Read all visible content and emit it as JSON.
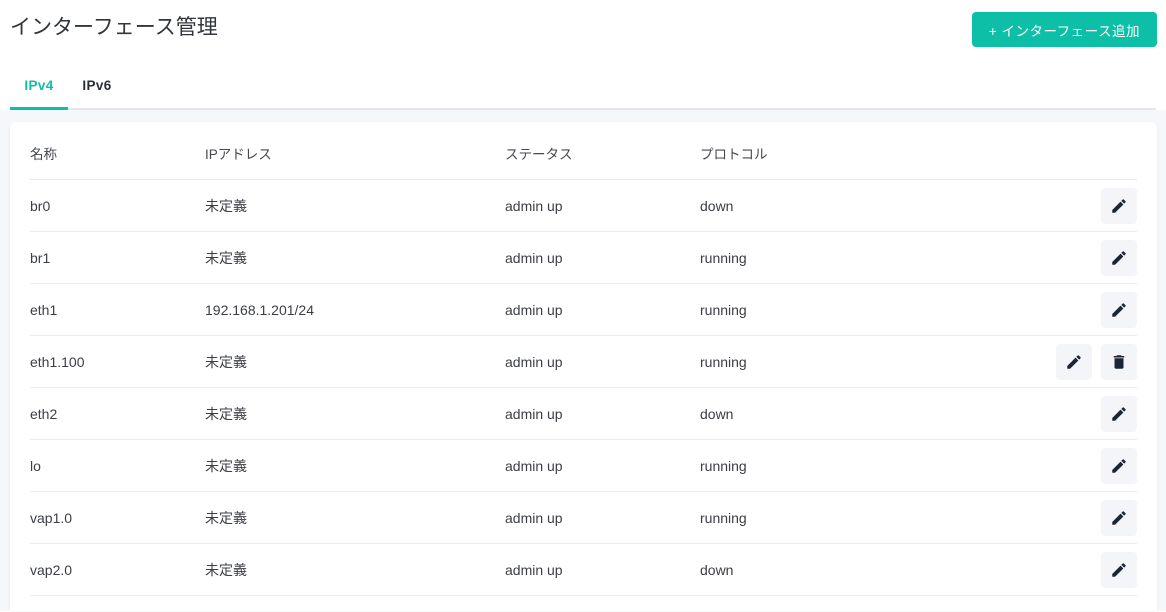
{
  "header": {
    "title": "インターフェース管理",
    "add_button_label": "+  インターフェース追加"
  },
  "tabs": [
    {
      "label": "IPv4",
      "active": true
    },
    {
      "label": "IPv6",
      "active": false
    }
  ],
  "table": {
    "columns": [
      "名称",
      "IPアドレス",
      "ステータス",
      "プロトコル"
    ],
    "rows": [
      {
        "name": "br0",
        "ip": "未定義",
        "status": "admin up",
        "protocol": "down",
        "actions": [
          "edit"
        ]
      },
      {
        "name": "br1",
        "ip": "未定義",
        "status": "admin up",
        "protocol": "running",
        "actions": [
          "edit"
        ]
      },
      {
        "name": "eth1",
        "ip": "192.168.1.201/24",
        "status": "admin up",
        "protocol": "running",
        "actions": [
          "edit"
        ]
      },
      {
        "name": "eth1.100",
        "ip": "未定義",
        "status": "admin up",
        "protocol": "running",
        "actions": [
          "edit",
          "delete"
        ]
      },
      {
        "name": "eth2",
        "ip": "未定義",
        "status": "admin up",
        "protocol": "down",
        "actions": [
          "edit"
        ]
      },
      {
        "name": "lo",
        "ip": "未定義",
        "status": "admin up",
        "protocol": "running",
        "actions": [
          "edit"
        ]
      },
      {
        "name": "vap1.0",
        "ip": "未定義",
        "status": "admin up",
        "protocol": "running",
        "actions": [
          "edit"
        ]
      },
      {
        "name": "vap2.0",
        "ip": "未定義",
        "status": "admin up",
        "protocol": "down",
        "actions": [
          "edit"
        ]
      }
    ]
  },
  "colors": {
    "accent_teal": "#0dbfa6",
    "page_background": "#f6f7fa",
    "card_background": "#ffffff",
    "icon_button_background": "#f3f5f9",
    "icon_color": "#1c2533",
    "divider": "#ededee"
  }
}
